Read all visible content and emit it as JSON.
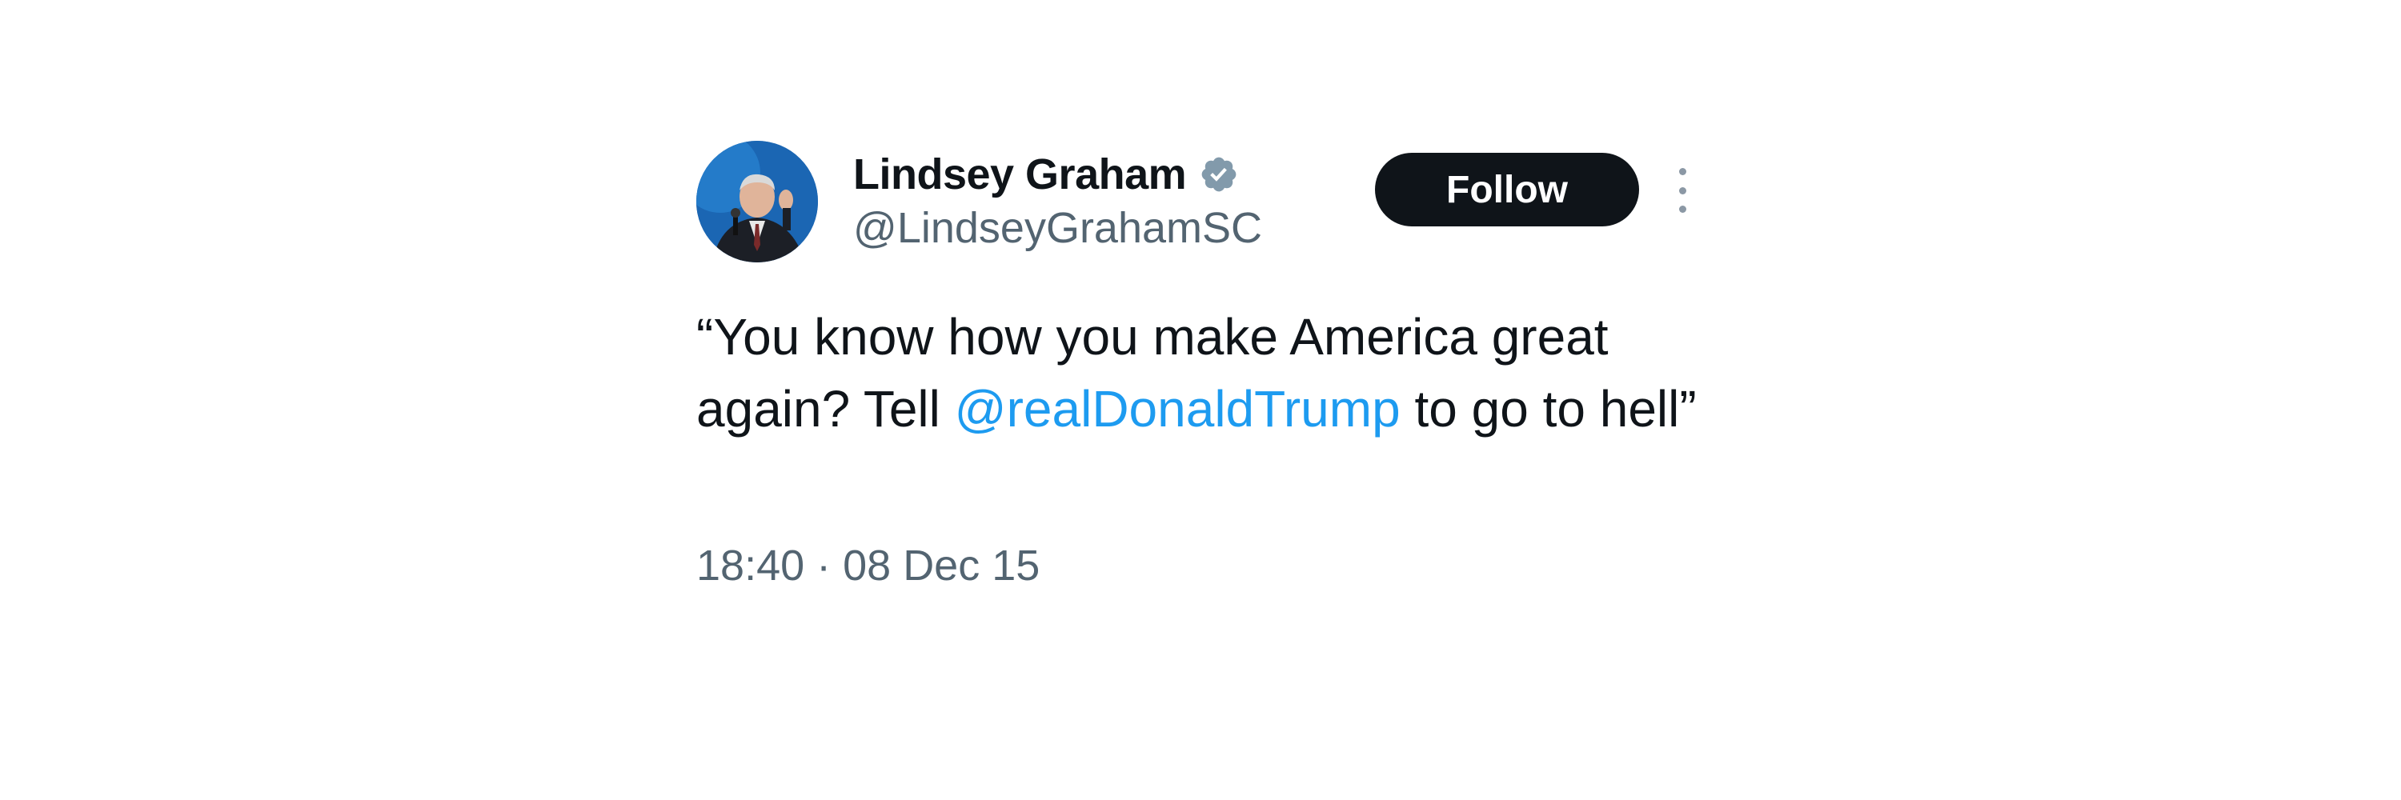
{
  "author": {
    "display_name": "Lindsey Graham",
    "handle": "@LindseyGrahamSC",
    "verified": true
  },
  "follow_button": {
    "label": "Follow"
  },
  "tweet": {
    "text_before": "“You know how you make America great again? Tell ",
    "mention": "@realDonaldTrump",
    "text_after": " to go to hell”",
    "timestamp": "18:40 · 08 Dec 15"
  },
  "colors": {
    "text": "#0f1419",
    "secondary": "#536471",
    "link": "#1d9bf0",
    "button_bg": "#0f1419",
    "verified": "#829aab"
  },
  "icons": {
    "verified": "verified-badge-icon",
    "more": "more-vertical-icon"
  }
}
